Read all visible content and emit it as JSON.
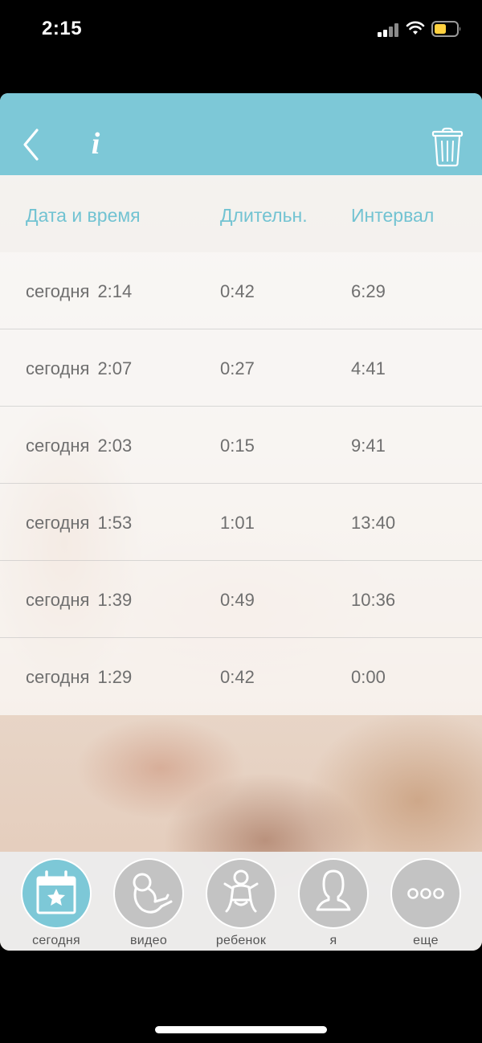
{
  "status_bar": {
    "time": "2:15"
  },
  "header": {
    "info_label": "i"
  },
  "table": {
    "columns": [
      "Дата и время",
      "Длительн.",
      "Интервал"
    ],
    "rows": [
      {
        "day": "сегодня",
        "time": "2:14",
        "duration": "0:42",
        "interval": "6:29"
      },
      {
        "day": "сегодня",
        "time": "2:07",
        "duration": "0:27",
        "interval": "4:41"
      },
      {
        "day": "сегодня",
        "time": "2:03",
        "duration": "0:15",
        "interval": "9:41"
      },
      {
        "day": "сегодня",
        "time": "1:53",
        "duration": "1:01",
        "interval": "13:40"
      },
      {
        "day": "сегодня",
        "time": "1:39",
        "duration": "0:49",
        "interval": "10:36"
      },
      {
        "day": "сегодня",
        "time": "1:29",
        "duration": "0:42",
        "interval": "0:00"
      }
    ]
  },
  "tabbar": {
    "tabs": [
      {
        "label": "сегодня",
        "icon": "calendar-star-icon",
        "active": true
      },
      {
        "label": "видео",
        "icon": "fetus-icon",
        "active": false
      },
      {
        "label": "ребенок",
        "icon": "baby-icon",
        "active": false
      },
      {
        "label": "я",
        "icon": "woman-silhouette-icon",
        "active": false
      },
      {
        "label": "еще",
        "icon": "more-dots-icon",
        "active": false
      }
    ]
  },
  "colors": {
    "accent": "#7dc8d7",
    "header_text": "#72c3d2",
    "cell_text": "#6f6f6f",
    "tab_inactive": "#c3c3c3"
  }
}
